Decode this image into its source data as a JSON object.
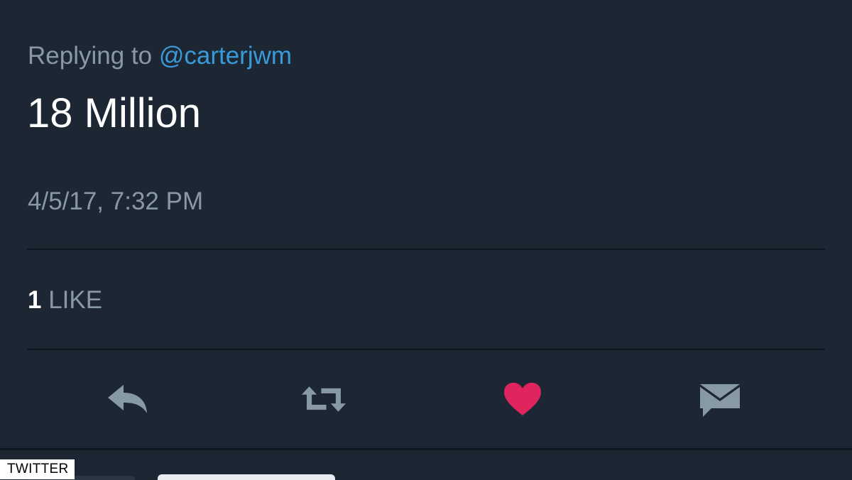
{
  "tweet": {
    "replying_prefix": "Replying to ",
    "replying_handle": "@carterjwm",
    "text": "18 Million",
    "timestamp": "4/5/17, 7:32 PM",
    "likes_count": "1",
    "likes_label": " LIKE"
  },
  "actions": {
    "reply_icon": "reply-icon",
    "retweet_icon": "retweet-icon",
    "like_icon": "heart-icon",
    "dm_icon": "envelope-icon"
  },
  "colors": {
    "background": "#1c2733",
    "muted_text": "#8899a6",
    "link": "#3a9ad9",
    "text": "#ffffff",
    "like_active": "#e0245e",
    "icon": "#8899a6"
  },
  "watermark": "TWITTER"
}
